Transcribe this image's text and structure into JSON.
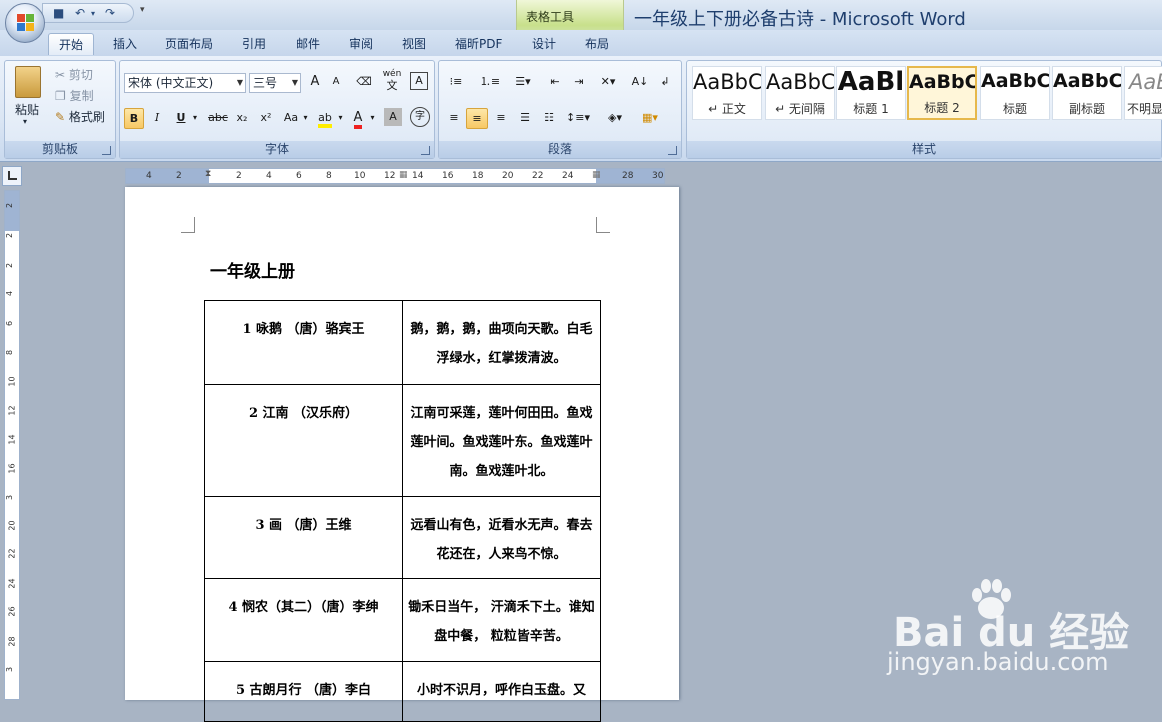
{
  "window": {
    "title": "一年级上下册必备古诗 - Microsoft Word",
    "context_tab_group": "表格工具"
  },
  "ribbon_tabs": [
    {
      "label": "开始",
      "active": true
    },
    {
      "label": "插入"
    },
    {
      "label": "页面布局"
    },
    {
      "label": "引用"
    },
    {
      "label": "邮件"
    },
    {
      "label": "审阅"
    },
    {
      "label": "视图"
    },
    {
      "label": "福昕PDF"
    },
    {
      "label": "设计"
    },
    {
      "label": "布局"
    }
  ],
  "clipboard": {
    "group_label": "剪贴板",
    "paste": "粘贴",
    "cut": "剪切",
    "copy": "复制",
    "format_painter": "格式刷"
  },
  "font": {
    "group_label": "字体",
    "font_name": "宋体 (中文正文)",
    "font_size": "三号",
    "bold": "B",
    "italic": "I",
    "underline": "U",
    "strikethrough": "abc",
    "subscript": "x₂",
    "superscript": "x²",
    "change_case": "Aa",
    "grow": "A",
    "shrink": "A",
    "char_border": "A",
    "char_shading": "A",
    "wen_glyph": "wén",
    "wen_char": "文",
    "phonetic_char": "字",
    "enclosed_char": "字",
    "highlight": "ab",
    "font_color": "A"
  },
  "paragraph": {
    "group_label": "段落"
  },
  "styles": {
    "group_label": "样式",
    "items": [
      {
        "sample": "AaBbC",
        "name": "↵ 正文"
      },
      {
        "sample": "AaBbC",
        "name": "↵ 无间隔"
      },
      {
        "sample": "AaBl",
        "name": "标题 1"
      },
      {
        "sample": "AaBbC",
        "name": "标题 2",
        "selected": true
      },
      {
        "sample": "AaBbC",
        "name": "标题"
      },
      {
        "sample": "AaBbC",
        "name": "副标题"
      },
      {
        "sample": "AaBl",
        "name": "不明显"
      }
    ]
  },
  "ruler": {
    "h_ticks": [
      "4",
      "2",
      "2",
      "4",
      "6",
      "8",
      "10",
      "12",
      "14",
      "16",
      "18",
      "20",
      "22",
      "24",
      "28",
      "30"
    ],
    "v_ticks": [
      "2",
      "2",
      "2",
      "4",
      "6",
      "8",
      "10",
      "12",
      "14",
      "16",
      "3",
      "20",
      "22",
      "24",
      "26",
      "28",
      "3"
    ]
  },
  "document": {
    "heading": "一年级上册",
    "rows": [
      {
        "title": "1 咏鹅  （唐）骆宾王",
        "content": "鹅，鹅，鹅，曲项向天歌。白毛浮绿水，红掌拨清波。"
      },
      {
        "title": "2 江南   （汉乐府）",
        "content": "江南可采莲，莲叶何田田。鱼戏莲叶间。鱼戏莲叶东。鱼戏莲叶南。鱼戏莲叶北。"
      },
      {
        "title": "3 画  （唐）王维",
        "content": "远看山有色，近看水无声。春去花还在，人来鸟不惊。"
      },
      {
        "title": "4 悯农（其二）（唐）李绅",
        "content": "锄禾日当午， 汗滴禾下土。谁知盘中餐， 粒粒皆辛苦。"
      },
      {
        "title": "5 古朗月行  （唐）李白",
        "content": "小时不识月，呼作白玉盘。又"
      }
    ]
  },
  "watermark": {
    "brand": "Bai  du 经验",
    "url": "jingyan.baidu.com"
  },
  "colors": {
    "ribbon_bg": "#dbe6f4",
    "context_tab": "#c8e08b",
    "selected_style": "#e6b84b"
  }
}
